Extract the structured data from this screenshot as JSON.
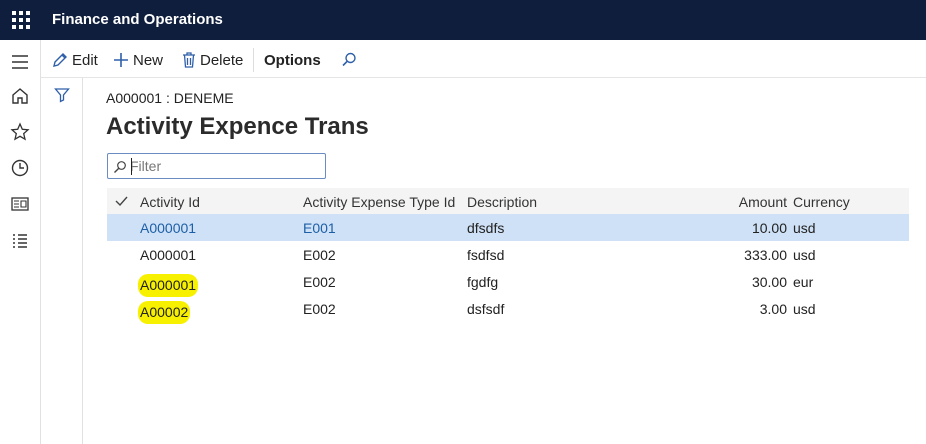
{
  "app": {
    "title": "Finance and Operations"
  },
  "navrail": {
    "items": [
      "hamburger-icon",
      "home-icon",
      "star-icon",
      "clock-icon",
      "workspace-icon",
      "list-icon"
    ]
  },
  "actions": {
    "edit": "Edit",
    "new": "New",
    "delete": "Delete",
    "options": "Options"
  },
  "page": {
    "breadcrumb": "A000001 : DENEME",
    "title": "Activity Expence Trans"
  },
  "filter": {
    "placeholder": "Filter",
    "value": ""
  },
  "grid": {
    "columns": [
      "Activity Id",
      "Activity Expense Type Id",
      "Description",
      "Amount",
      "Currency"
    ],
    "rows": [
      {
        "activity_id": "A000001",
        "type_id": "E001",
        "description": "dfsdfs",
        "amount": "10.00",
        "currency": "usd"
      },
      {
        "activity_id": "A000001",
        "type_id": "E002",
        "description": "fsdfsd",
        "amount": "333.00",
        "currency": "usd"
      },
      {
        "activity_id": "A000001",
        "type_id": "E002",
        "description": "fgdfg",
        "amount": "30.00",
        "currency": "eur"
      },
      {
        "activity_id": "A00002",
        "type_id": "E002",
        "description": "dsfsdf",
        "amount": "3.00",
        "currency": "usd"
      }
    ]
  },
  "colors": {
    "topbar": "#0f1e3d",
    "selected_row": "#cfe1f6",
    "link": "#1d5fa6",
    "highlight": "#f7f100"
  }
}
